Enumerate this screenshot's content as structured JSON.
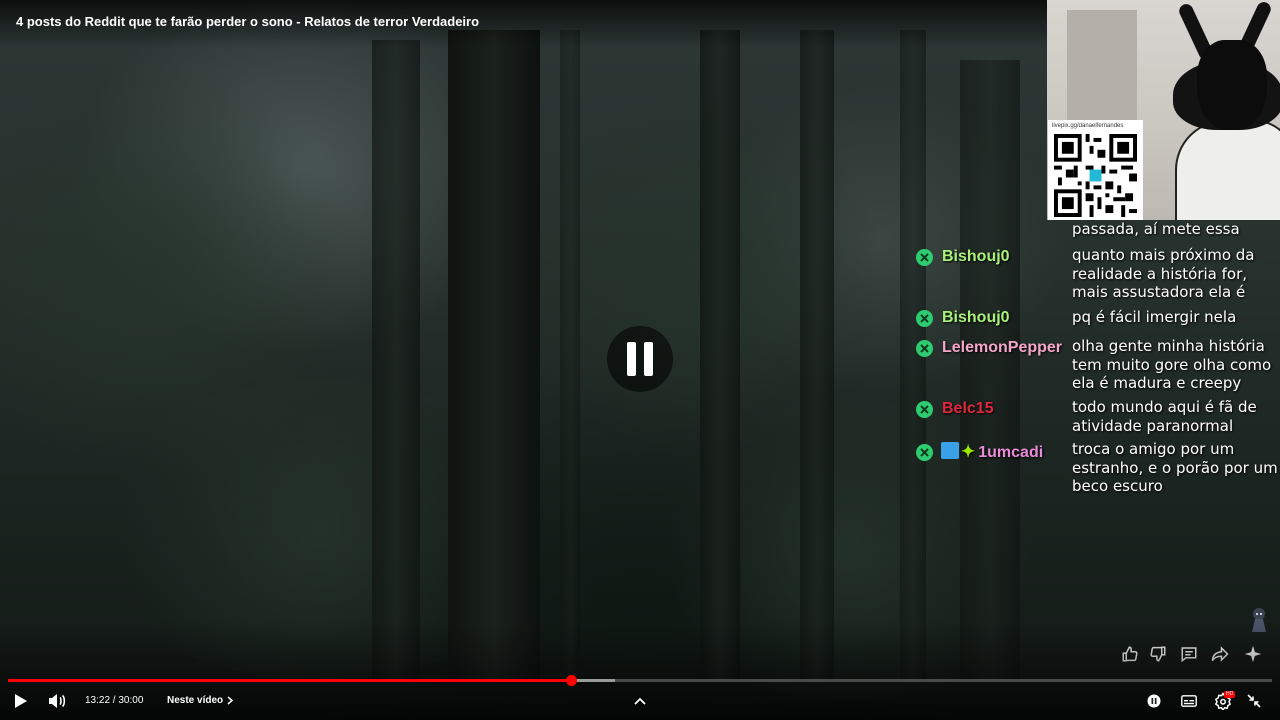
{
  "video": {
    "title": "4 posts do Reddit que te farão perder o sono - Relatos de terror Verdadeiro"
  },
  "overlay": {
    "qr_url": "livepix.gg/danaelfernandes"
  },
  "chat": {
    "partial_message": "passada, aí mete essa",
    "messages": [
      {
        "user": "Bishouj0",
        "color": "#a8f07a",
        "text": "quanto mais próximo da realidade a história for, mais assustadora ela é"
      },
      {
        "user": "Bishouj0",
        "color": "#a8f07a",
        "text": "pq é fácil imergir nela"
      },
      {
        "user": "LelemonPepper",
        "color": "#f5a7c8",
        "text": "olha gente minha história tem muito gore olha como ela é madura e creepy"
      },
      {
        "user": "Belc15",
        "color": "#e0263c",
        "text": "todo mundo aqui é fã de atividade paranormal"
      },
      {
        "user": "1umcadi",
        "color": "#e98bd6",
        "text": "troca o amigo por um estranho, e o porão por um beco escuro"
      }
    ]
  },
  "player": {
    "time_display": "13:22 / 30:00",
    "chapter_label": "Neste vídeo",
    "progress": 0.4457,
    "buffered": 0.48,
    "state": "paused-indicator",
    "settings_badge": "HD"
  },
  "icons": [
    "play-icon",
    "volume-icon",
    "chevron-right-icon",
    "chevron-up-icon",
    "autoplay-toggle-icon",
    "subtitles-icon",
    "settings-icon",
    "exit-fullscreen-icon",
    "like-icon",
    "dislike-icon",
    "comments-icon",
    "share-icon",
    "sparkle-icon",
    "pause-icon",
    "moderator-badge-icon"
  ],
  "colors": {
    "progress": "#ff0000",
    "chat_badge": "#2ecc71"
  }
}
